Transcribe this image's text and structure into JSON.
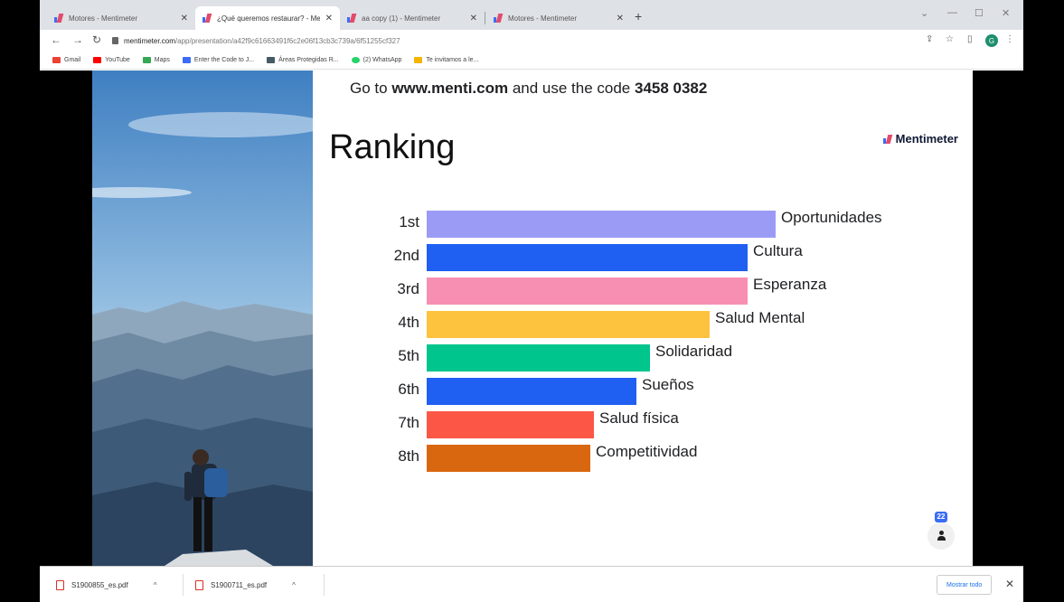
{
  "browser": {
    "tabs": [
      {
        "title": "Motores - Mentimeter",
        "active": false
      },
      {
        "title": "¿Qué queremos restaurar? - Me",
        "active": true
      },
      {
        "title": "aa copy (1) - Mentimeter",
        "active": false
      },
      {
        "title": "Motores - Mentimeter",
        "active": false
      }
    ],
    "new_tab": "+",
    "url_host": "mentimeter.com",
    "url_path": "/app/presentation/a42f9c61663491f6c2e06f13cb3c739a/6f51255cf327",
    "profile_initial": "G",
    "bookmarks": [
      {
        "label": "Gmail",
        "color": "#ea4335"
      },
      {
        "label": "YouTube",
        "color": "#ff0000"
      },
      {
        "label": "Maps",
        "color": "#34a853"
      },
      {
        "label": "Enter the Code to J...",
        "color": "#3b6cf6"
      },
      {
        "label": "Áreas Protegidas R...",
        "color": "#455a64"
      },
      {
        "label": "(2) WhatsApp",
        "color": "#25d366"
      },
      {
        "label": "Te invitamos a le...",
        "color": "#f4b400"
      }
    ]
  },
  "slide": {
    "join_prefix": "Go to ",
    "join_url": "www.menti.com",
    "join_middle": " and use the code ",
    "join_code": "3458 0382",
    "title": "Ranking",
    "brand": "Mentimeter",
    "participant_count": "22"
  },
  "chart_data": {
    "type": "bar",
    "orientation": "horizontal",
    "title": "Ranking",
    "ranks": [
      "1st",
      "2nd",
      "3rd",
      "4th",
      "5th",
      "6th",
      "7th",
      "8th"
    ],
    "categories": [
      "Oportunidades",
      "Cultura",
      "Esperanza",
      "Salud Mental",
      "Solidaridad",
      "Sueños",
      "Salud física",
      "Competitividad"
    ],
    "values": [
      100,
      92,
      92,
      81,
      64,
      60,
      48,
      47
    ],
    "colors": [
      "#9b9bf5",
      "#1f5ff2",
      "#f78fb3",
      "#fdc33e",
      "#00c58c",
      "#1f5ff2",
      "#fc5646",
      "#d9670f"
    ]
  },
  "downloads": {
    "items": [
      "S1900855_es.pdf",
      "S1900711_es.pdf"
    ],
    "show_all": "Mostrar todo"
  }
}
